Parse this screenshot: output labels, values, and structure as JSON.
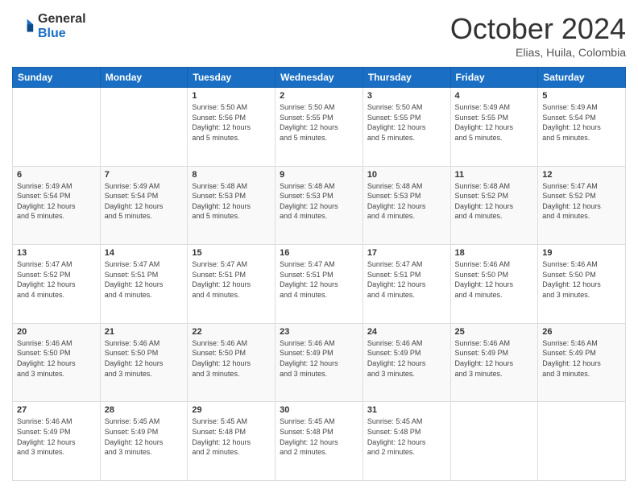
{
  "logo": {
    "general": "General",
    "blue": "Blue"
  },
  "header": {
    "month": "October 2024",
    "location": "Elias, Huila, Colombia"
  },
  "days_of_week": [
    "Sunday",
    "Monday",
    "Tuesday",
    "Wednesday",
    "Thursday",
    "Friday",
    "Saturday"
  ],
  "weeks": [
    [
      {
        "day": "",
        "info": ""
      },
      {
        "day": "",
        "info": ""
      },
      {
        "day": "1",
        "info": "Sunrise: 5:50 AM\nSunset: 5:56 PM\nDaylight: 12 hours\nand 5 minutes."
      },
      {
        "day": "2",
        "info": "Sunrise: 5:50 AM\nSunset: 5:55 PM\nDaylight: 12 hours\nand 5 minutes."
      },
      {
        "day": "3",
        "info": "Sunrise: 5:50 AM\nSunset: 5:55 PM\nDaylight: 12 hours\nand 5 minutes."
      },
      {
        "day": "4",
        "info": "Sunrise: 5:49 AM\nSunset: 5:55 PM\nDaylight: 12 hours\nand 5 minutes."
      },
      {
        "day": "5",
        "info": "Sunrise: 5:49 AM\nSunset: 5:54 PM\nDaylight: 12 hours\nand 5 minutes."
      }
    ],
    [
      {
        "day": "6",
        "info": "Sunrise: 5:49 AM\nSunset: 5:54 PM\nDaylight: 12 hours\nand 5 minutes."
      },
      {
        "day": "7",
        "info": "Sunrise: 5:49 AM\nSunset: 5:54 PM\nDaylight: 12 hours\nand 5 minutes."
      },
      {
        "day": "8",
        "info": "Sunrise: 5:48 AM\nSunset: 5:53 PM\nDaylight: 12 hours\nand 5 minutes."
      },
      {
        "day": "9",
        "info": "Sunrise: 5:48 AM\nSunset: 5:53 PM\nDaylight: 12 hours\nand 4 minutes."
      },
      {
        "day": "10",
        "info": "Sunrise: 5:48 AM\nSunset: 5:53 PM\nDaylight: 12 hours\nand 4 minutes."
      },
      {
        "day": "11",
        "info": "Sunrise: 5:48 AM\nSunset: 5:52 PM\nDaylight: 12 hours\nand 4 minutes."
      },
      {
        "day": "12",
        "info": "Sunrise: 5:47 AM\nSunset: 5:52 PM\nDaylight: 12 hours\nand 4 minutes."
      }
    ],
    [
      {
        "day": "13",
        "info": "Sunrise: 5:47 AM\nSunset: 5:52 PM\nDaylight: 12 hours\nand 4 minutes."
      },
      {
        "day": "14",
        "info": "Sunrise: 5:47 AM\nSunset: 5:51 PM\nDaylight: 12 hours\nand 4 minutes."
      },
      {
        "day": "15",
        "info": "Sunrise: 5:47 AM\nSunset: 5:51 PM\nDaylight: 12 hours\nand 4 minutes."
      },
      {
        "day": "16",
        "info": "Sunrise: 5:47 AM\nSunset: 5:51 PM\nDaylight: 12 hours\nand 4 minutes."
      },
      {
        "day": "17",
        "info": "Sunrise: 5:47 AM\nSunset: 5:51 PM\nDaylight: 12 hours\nand 4 minutes."
      },
      {
        "day": "18",
        "info": "Sunrise: 5:46 AM\nSunset: 5:50 PM\nDaylight: 12 hours\nand 4 minutes."
      },
      {
        "day": "19",
        "info": "Sunrise: 5:46 AM\nSunset: 5:50 PM\nDaylight: 12 hours\nand 3 minutes."
      }
    ],
    [
      {
        "day": "20",
        "info": "Sunrise: 5:46 AM\nSunset: 5:50 PM\nDaylight: 12 hours\nand 3 minutes."
      },
      {
        "day": "21",
        "info": "Sunrise: 5:46 AM\nSunset: 5:50 PM\nDaylight: 12 hours\nand 3 minutes."
      },
      {
        "day": "22",
        "info": "Sunrise: 5:46 AM\nSunset: 5:50 PM\nDaylight: 12 hours\nand 3 minutes."
      },
      {
        "day": "23",
        "info": "Sunrise: 5:46 AM\nSunset: 5:49 PM\nDaylight: 12 hours\nand 3 minutes."
      },
      {
        "day": "24",
        "info": "Sunrise: 5:46 AM\nSunset: 5:49 PM\nDaylight: 12 hours\nand 3 minutes."
      },
      {
        "day": "25",
        "info": "Sunrise: 5:46 AM\nSunset: 5:49 PM\nDaylight: 12 hours\nand 3 minutes."
      },
      {
        "day": "26",
        "info": "Sunrise: 5:46 AM\nSunset: 5:49 PM\nDaylight: 12 hours\nand 3 minutes."
      }
    ],
    [
      {
        "day": "27",
        "info": "Sunrise: 5:46 AM\nSunset: 5:49 PM\nDaylight: 12 hours\nand 3 minutes."
      },
      {
        "day": "28",
        "info": "Sunrise: 5:45 AM\nSunset: 5:49 PM\nDaylight: 12 hours\nand 3 minutes."
      },
      {
        "day": "29",
        "info": "Sunrise: 5:45 AM\nSunset: 5:48 PM\nDaylight: 12 hours\nand 2 minutes."
      },
      {
        "day": "30",
        "info": "Sunrise: 5:45 AM\nSunset: 5:48 PM\nDaylight: 12 hours\nand 2 minutes."
      },
      {
        "day": "31",
        "info": "Sunrise: 5:45 AM\nSunset: 5:48 PM\nDaylight: 12 hours\nand 2 minutes."
      },
      {
        "day": "",
        "info": ""
      },
      {
        "day": "",
        "info": ""
      }
    ]
  ]
}
